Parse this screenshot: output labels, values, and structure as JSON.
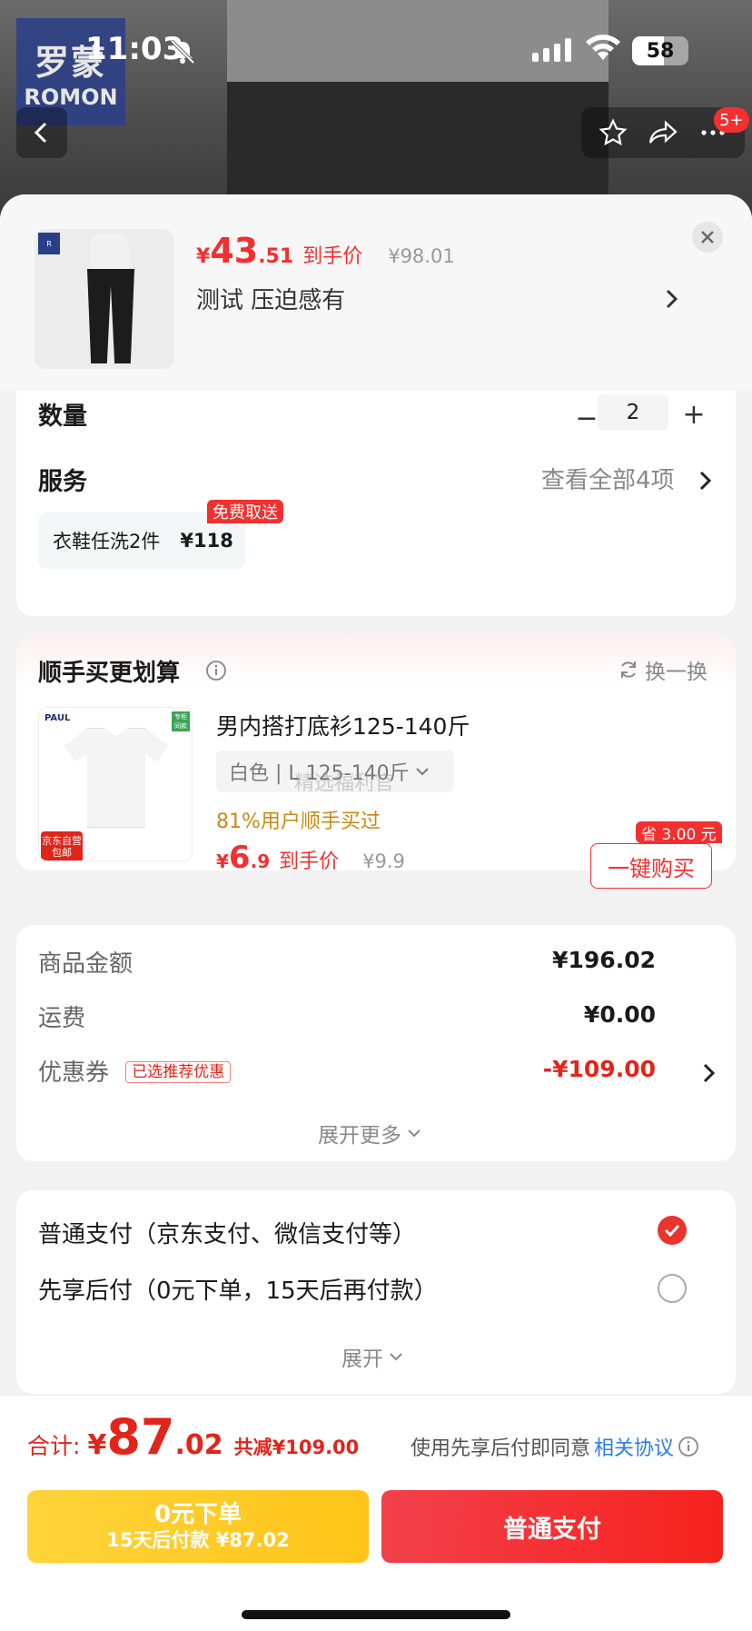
{
  "status": {
    "time": "11:03",
    "battery": "58"
  },
  "nav": {
    "badge": "5+"
  },
  "backdrop": {
    "brand_cn": "罗蒙",
    "brand_en": "ROMON"
  },
  "product": {
    "price_currency": "¥",
    "price_int": "43",
    "price_dec": ".51",
    "price_tag": "到手价",
    "original_price": "¥98.01",
    "spec": "测试  压迫感有"
  },
  "quantity": {
    "label": "数量",
    "value": "2",
    "minus": "−",
    "plus": "+"
  },
  "service": {
    "label": "服务",
    "view_all": "查看全部4项",
    "item_name": "衣鞋任洗2件",
    "item_price": "¥118",
    "item_tag": "免费取送"
  },
  "bundle": {
    "title": "顺手买更划算",
    "swap": "换一换",
    "name": "男内搭打底衫125-140斤",
    "sku": "白色 | L 125-140斤",
    "watermark": "精选福利官",
    "bought": "81%用户顺手买过",
    "price_currency": "¥",
    "price_int": "6",
    "price_dec": ".9",
    "price_tag": "到手价",
    "original_price": "¥9.9",
    "buy_label": "一键购买",
    "save_tag": "省 3.00 元",
    "img_brand": "PAUL",
    "img_green": "专柜同款",
    "img_jd1": "京东自营",
    "img_jd2": "包邮"
  },
  "amounts": {
    "goods_label": "商品金额",
    "goods_value": "¥196.02",
    "shipping_label": "运费",
    "shipping_value": "¥0.00",
    "coupon_label": "优惠券",
    "coupon_tag": "已选推荐优惠",
    "coupon_value": "-¥109.00",
    "expand_label": "展开更多"
  },
  "payment": {
    "option1": "普通支付（京东支付、微信支付等）",
    "option2": "先享后付（0元下单，15天后再付款）",
    "expand_label": "展开"
  },
  "footer": {
    "total_label": "合计:",
    "total_currency": "¥",
    "total_int": "87",
    "total_dec": ".02",
    "total_save": "共减¥109.00",
    "agree_text": "使用先享后付即同意",
    "agree_link": "相关协议",
    "later_line1": "0元下单",
    "later_line2": "15天后付款 ¥87.02",
    "pay_label": "普通支付"
  },
  "colors": {
    "accent": "#f23030",
    "pay_button": "#f5221c",
    "later_button": "#ffc418",
    "link": "#2b7de9"
  }
}
